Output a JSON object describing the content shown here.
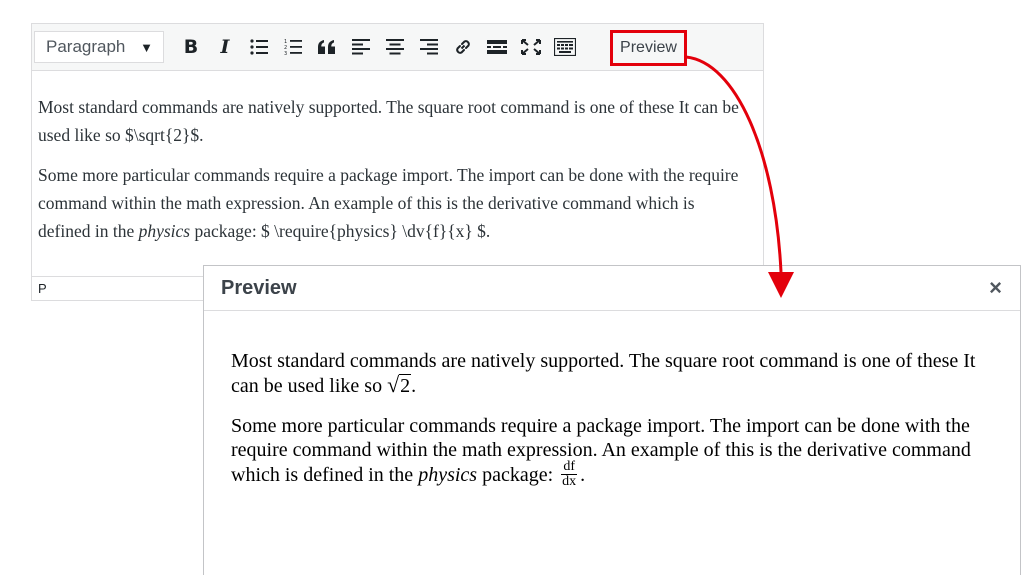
{
  "editor": {
    "format_select": "Paragraph",
    "format_arrow": "▼",
    "bold_label": "B",
    "italic_label": "I",
    "preview_label": "Preview",
    "paragraphs": [
      {
        "text": "Most standard commands are natively supported. The square root command is one of these It can be used like so $\\sqrt{2}$."
      },
      {
        "before": "Some more particular commands require a package import. The import can be done with the require command within the math expression. An example of this is the derivative command which is defined in the ",
        "emph": "physics",
        "after": " package: $ \\require{physics} \\dv{f}{x} $."
      }
    ],
    "status_path": "P"
  },
  "preview_modal": {
    "title": "Preview",
    "close_symbol": "×",
    "p1_text": "Most standard commands are natively supported. The square root command is one of these It can be used like so ",
    "p1_radicand": "2",
    "p1_end": ".",
    "p2_before": "Some more particular commands require a package import. The import can be done with the require command within the math expression. An example of this is the derivative command which is defined in the ",
    "p2_emph": "physics",
    "p2_after": " package: ",
    "frac_num": "df",
    "frac_den": "dx",
    "p2_end": "."
  },
  "colors": {
    "highlight": "#e3000b",
    "toolbar_bg": "#f6f7f7",
    "border": "#dcdcde"
  }
}
